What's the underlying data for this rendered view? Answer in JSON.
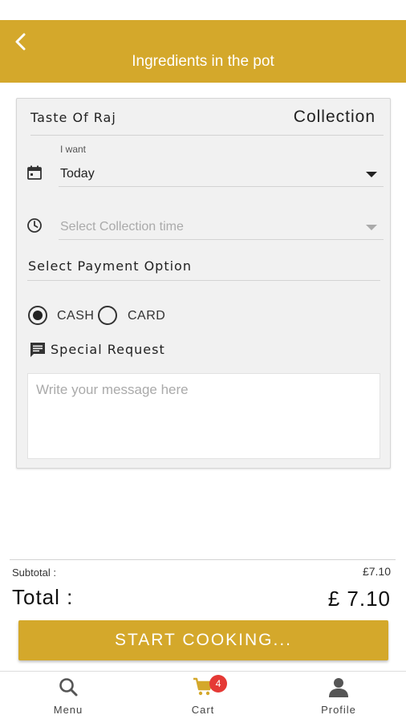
{
  "header": {
    "title": "Ingredients in the pot",
    "back_icon": "chevron-left-icon"
  },
  "order": {
    "restaurant": "Taste Of Raj",
    "mode": "Collection",
    "when_label": "I want",
    "when_value": "Today",
    "time_placeholder": "Select Collection time",
    "payment_label": "Select Payment Option",
    "payment_options": [
      {
        "label": "CASH",
        "selected": true
      },
      {
        "label": "CARD",
        "selected": false
      }
    ],
    "special_request_label": "Special Request",
    "message_placeholder": "Write your message here"
  },
  "totals": {
    "subtotal_label": "Subtotal :",
    "subtotal_value": "£7.10",
    "total_label": "Total :",
    "total_value": "£ 7.10"
  },
  "cta": {
    "label": "START COOKING..."
  },
  "bottom_nav": {
    "items": [
      {
        "label": "Menu",
        "icon": "search-icon"
      },
      {
        "label": "Cart",
        "icon": "cart-icon",
        "badge": "4"
      },
      {
        "label": "Profile",
        "icon": "person-icon"
      }
    ]
  },
  "colors": {
    "accent": "#d4a82b",
    "badge": "#e53935"
  }
}
